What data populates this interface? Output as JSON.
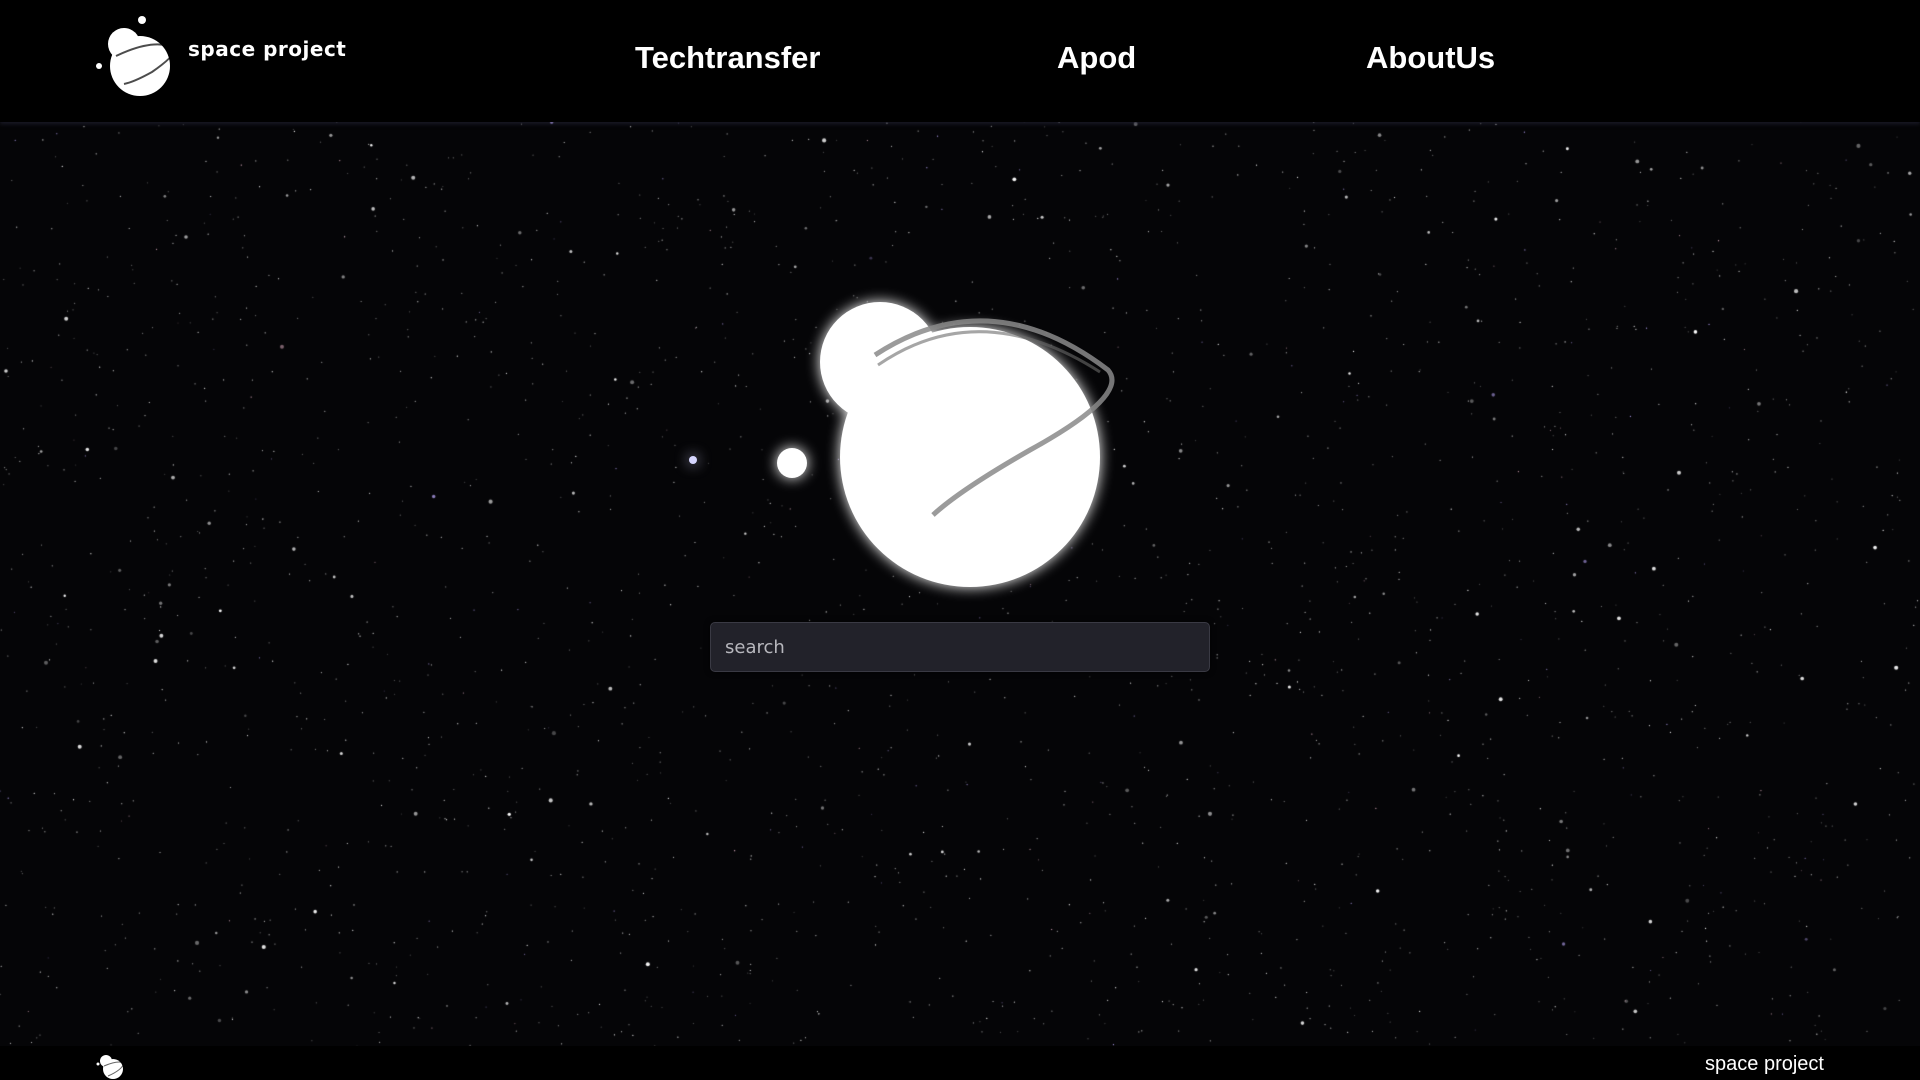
{
  "header": {
    "brand_name": "space project",
    "logo_icon": "planet-logo-icon",
    "nav": [
      {
        "label": "Techtransfer"
      },
      {
        "label": "Apod"
      },
      {
        "label": "AboutUs"
      }
    ]
  },
  "hero": {
    "logo_icon": "planet-logo-icon"
  },
  "search": {
    "placeholder": "search",
    "value": ""
  },
  "footer": {
    "logo_icon": "planet-logo-icon",
    "text": "space project"
  },
  "colors": {
    "background": "#050507",
    "header_bg": "#000000",
    "search_bg": "#22222a",
    "text": "#ffffff"
  }
}
